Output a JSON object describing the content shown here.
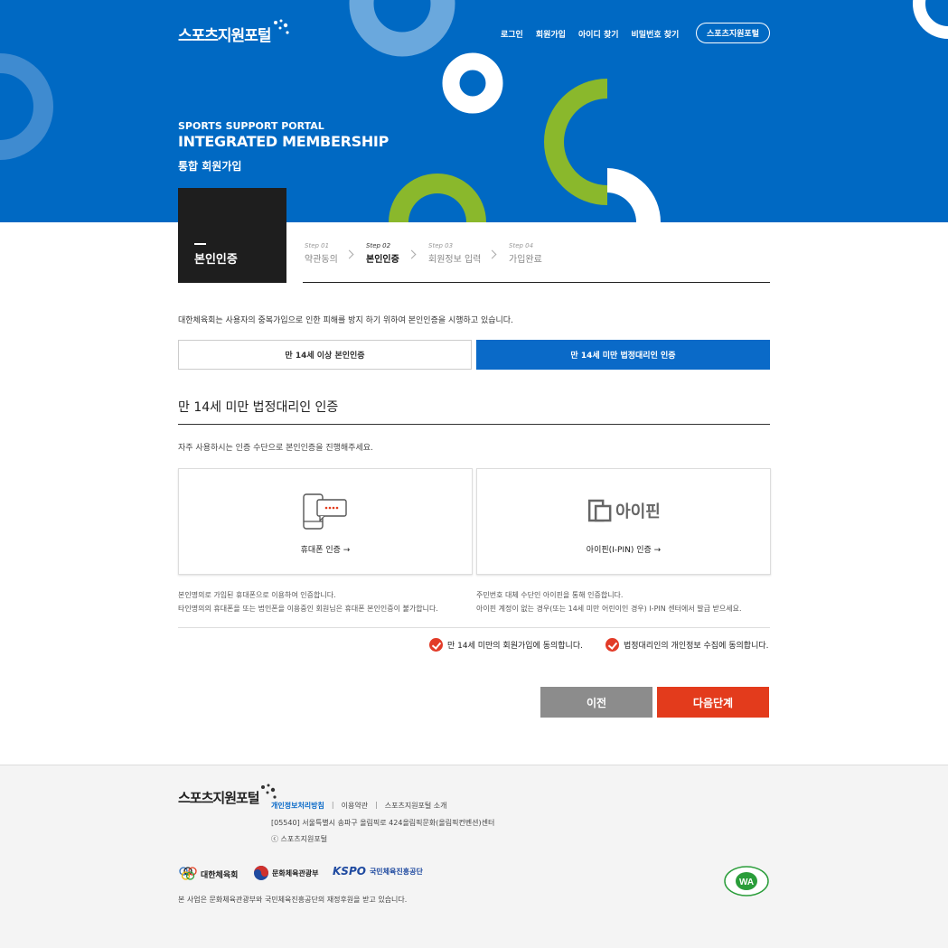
{
  "header": {
    "logo_text": "스포츠지원포털",
    "nav": [
      "로그인",
      "회원가입",
      "아이디 찾기",
      "비밀번호 찾기"
    ],
    "portal_button": "스포츠지원포털",
    "hero_sub": "SPORTS SUPPORT PORTAL",
    "hero_title": "INTEGRATED MEMBERSHIP",
    "hero_kor": "통합 회원가입"
  },
  "step_box": {
    "label": "본인인증"
  },
  "steps": [
    {
      "num": "Step 01",
      "name": "약관동의"
    },
    {
      "num": "Step 02",
      "name": "본인인증"
    },
    {
      "num": "Step 03",
      "name": "회원정보 입력"
    },
    {
      "num": "Step 04",
      "name": "가입완료"
    }
  ],
  "main": {
    "notice": "대한체육회는 사용자의 중복가입으로 인한 피해를 방지 하기 위하여 본인인증을 시행하고 있습니다.",
    "tab_adult": "만 14세 이상 본인인증",
    "tab_minor": "만 14세 미만 법정대리인 인증",
    "section_title": "만 14세 미만 법정대리인 인증",
    "section_desc": "자주 사용하시는 인증 수단으로 본인인증을 진행해주세요.",
    "card_phone": "휴대폰 인증 →",
    "card_ipin": "아이핀(I-PIN) 인증 →",
    "ipin_logo": "아이핀",
    "note_phone_1": "본인명의로 가입된 휴대폰으로 이용하여 인증합니다.",
    "note_phone_2": "타인명의의 휴대폰을 또는 법인폰을 이용중인 회원님은 휴대폰 본인인증이 불가합니다.",
    "note_ipin_1": "주민번호 대체 수단인 아이핀을 통해 인증합니다.",
    "note_ipin_2": "아이핀 계정이 없는 경우(또는 14세 미만 어린이인 경우) I-PIN 센터에서 발급 받으세요.",
    "agree_1": "만 14세 미만의 회원가입에 동의합니다.",
    "agree_2": "법정대리인의 개인정보 수집에 동의합니다.",
    "btn_prev": "이전",
    "btn_next": "다음단계"
  },
  "footer": {
    "logo_text": "스포츠지원포털",
    "links": [
      "개인정보처리방침",
      "이용약관",
      "스포츠지원포털 소개"
    ],
    "address": "[05540] 서울특별시 송파구 올림픽로 424올림픽문화(올림픽컨벤션)센터",
    "copyright": "ⓒ 스포츠지원포털",
    "orgs": [
      "대한체육회",
      "문화체육관광부",
      "국민체육진흥공단"
    ],
    "kspo": "KSPO",
    "sponsor": "본 사업은 문화체육관광부와 국민체육진흥공단의 재정후원을 받고 있습니다.",
    "wa": "WA"
  },
  "colors": {
    "primary": "#0069c3",
    "accent_green": "#8ab82c",
    "next_button": "#e33b1c",
    "prev_button": "#8c8c8c"
  }
}
